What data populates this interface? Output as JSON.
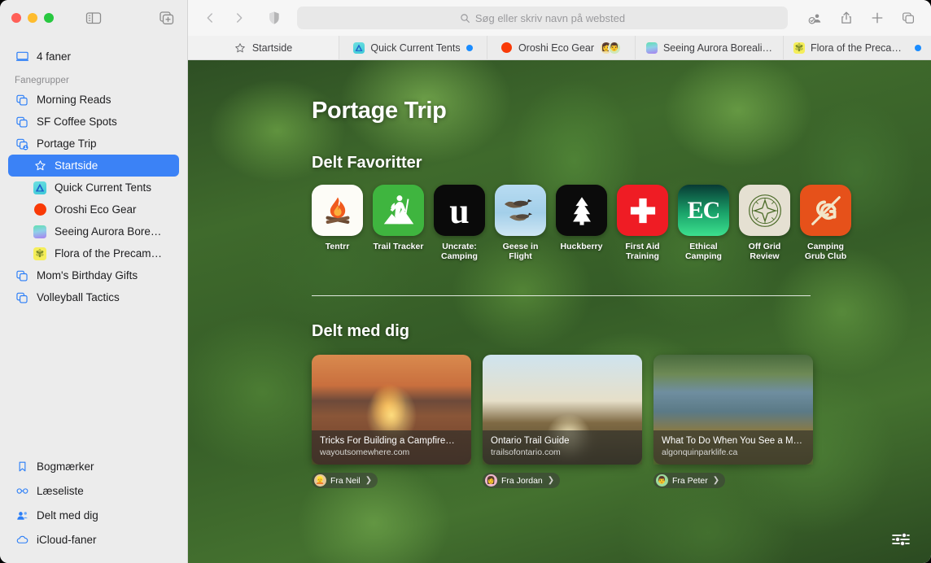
{
  "window": {
    "traffic_lights": [
      "close",
      "minimize",
      "zoom"
    ],
    "sidebar_toggle_icon": "sidebar-icon",
    "new_tab_group_icon": "new-tab-group-icon"
  },
  "sidebar": {
    "tabs_summary": {
      "label": "4 faner",
      "icon": "screen-icon"
    },
    "section_header": "Fanegrupper",
    "tab_groups": [
      {
        "label": "Morning Reads",
        "icon": "tab-group-icon"
      },
      {
        "label": "SF Coffee Spots",
        "icon": "tab-group-icon"
      },
      {
        "label": "Portage Trip",
        "icon": "shared-tab-group-icon"
      }
    ],
    "portage_children": [
      {
        "label": "Startside",
        "icon": "star-icon",
        "selected": true
      },
      {
        "label": "Quick Current Tents",
        "icon": "favicon-tents",
        "selected": false
      },
      {
        "label": "Oroshi Eco Gear",
        "icon": "favicon-oroshi",
        "selected": false
      },
      {
        "label": "Seeing Aurora Bore…",
        "icon": "favicon-aurora",
        "selected": false
      },
      {
        "label": "Flora of the Precam…",
        "icon": "favicon-flora",
        "selected": false
      }
    ],
    "more_groups": [
      {
        "label": "Mom's Birthday Gifts",
        "icon": "tab-group-icon"
      },
      {
        "label": "Volleyball Tactics",
        "icon": "tab-group-icon"
      }
    ],
    "bottom_items": [
      {
        "label": "Bogmærker",
        "icon": "bookmark-icon"
      },
      {
        "label": "Læseliste",
        "icon": "glasses-icon"
      },
      {
        "label": "Delt med dig",
        "icon": "shared-with-you-icon"
      },
      {
        "label": "iCloud-faner",
        "icon": "cloud-icon"
      }
    ]
  },
  "toolbar": {
    "back_icon": "chevron-left-icon",
    "forward_icon": "chevron-right-icon",
    "shield_icon": "privacy-shield-icon",
    "address_placeholder": "Søg eller skriv navn på websted",
    "search_icon": "search-icon",
    "right_icons": [
      "share-participants-icon",
      "share-icon",
      "new-tab-icon",
      "tab-overview-icon"
    ]
  },
  "tabs": [
    {
      "title": "Startside",
      "icon": "star-icon",
      "type": "start",
      "active": true,
      "unread": false
    },
    {
      "title": "Quick Current Tents",
      "icon": "favicon-tents",
      "type": "normal",
      "active": false,
      "unread": true
    },
    {
      "title": "Oroshi Eco Gear",
      "icon": "favicon-oroshi",
      "type": "normal",
      "active": false,
      "unread": false,
      "avatars": [
        "👩",
        "👨"
      ]
    },
    {
      "title": "Seeing Aurora Boreali…",
      "icon": "favicon-aurora",
      "type": "normal",
      "active": false,
      "unread": false
    },
    {
      "title": "Flora of the Precambi…",
      "icon": "favicon-flora",
      "type": "normal",
      "active": false,
      "unread": true
    }
  ],
  "startpage": {
    "title": "Portage Trip",
    "favorites_heading": "Delt Favoritter",
    "favorites": [
      {
        "name": "Tentrr",
        "icon": "campfire-icon",
        "tile": "t-tentrr"
      },
      {
        "name": "Trail Tracker",
        "icon": "hiker-icon",
        "tile": "t-trail"
      },
      {
        "name": "Uncrate: Camping",
        "icon": "letter-u-icon",
        "tile": "t-uncrate"
      },
      {
        "name": "Geese in Flight",
        "icon": "geese-icon",
        "tile": "t-geese"
      },
      {
        "name": "Huckberry",
        "icon": "pine-tree-icon",
        "tile": "t-huck"
      },
      {
        "name": "First Aid Training",
        "icon": "medical-cross-icon",
        "tile": "t-aid"
      },
      {
        "name": "Ethical Camping",
        "icon": "letters-ec-icon",
        "tile": "t-ec"
      },
      {
        "name": "Off Grid Review",
        "icon": "compass-icon",
        "tile": "t-offgrid"
      },
      {
        "name": "Camping Grub Club",
        "icon": "letters-cg-icon",
        "tile": "t-grub"
      }
    ],
    "shared_heading": "Delt med dig",
    "shared_cards": [
      {
        "title": "Tricks For Building a Campfire—F…",
        "url": "wayoutsomewhere.com",
        "from": "Fra Neil",
        "avatar": "👱",
        "image": "campfire-photo"
      },
      {
        "title": "Ontario Trail Guide",
        "url": "trailsofontario.com",
        "from": "Fra Jordan",
        "avatar": "👩",
        "image": "hiking-boots-photo"
      },
      {
        "title": "What To Do When You See a Moo…",
        "url": "algonquinparklife.ca",
        "from": "Fra Peter",
        "avatar": "👨",
        "image": "moose-photo"
      }
    ],
    "customize_icon": "sliders-icon"
  },
  "colors": {
    "accent": "#3b82f6",
    "unread_dot": "#1a8cff",
    "sidebar_bg": "#ececec",
    "toolbar_bg": "#f6f6f6"
  }
}
